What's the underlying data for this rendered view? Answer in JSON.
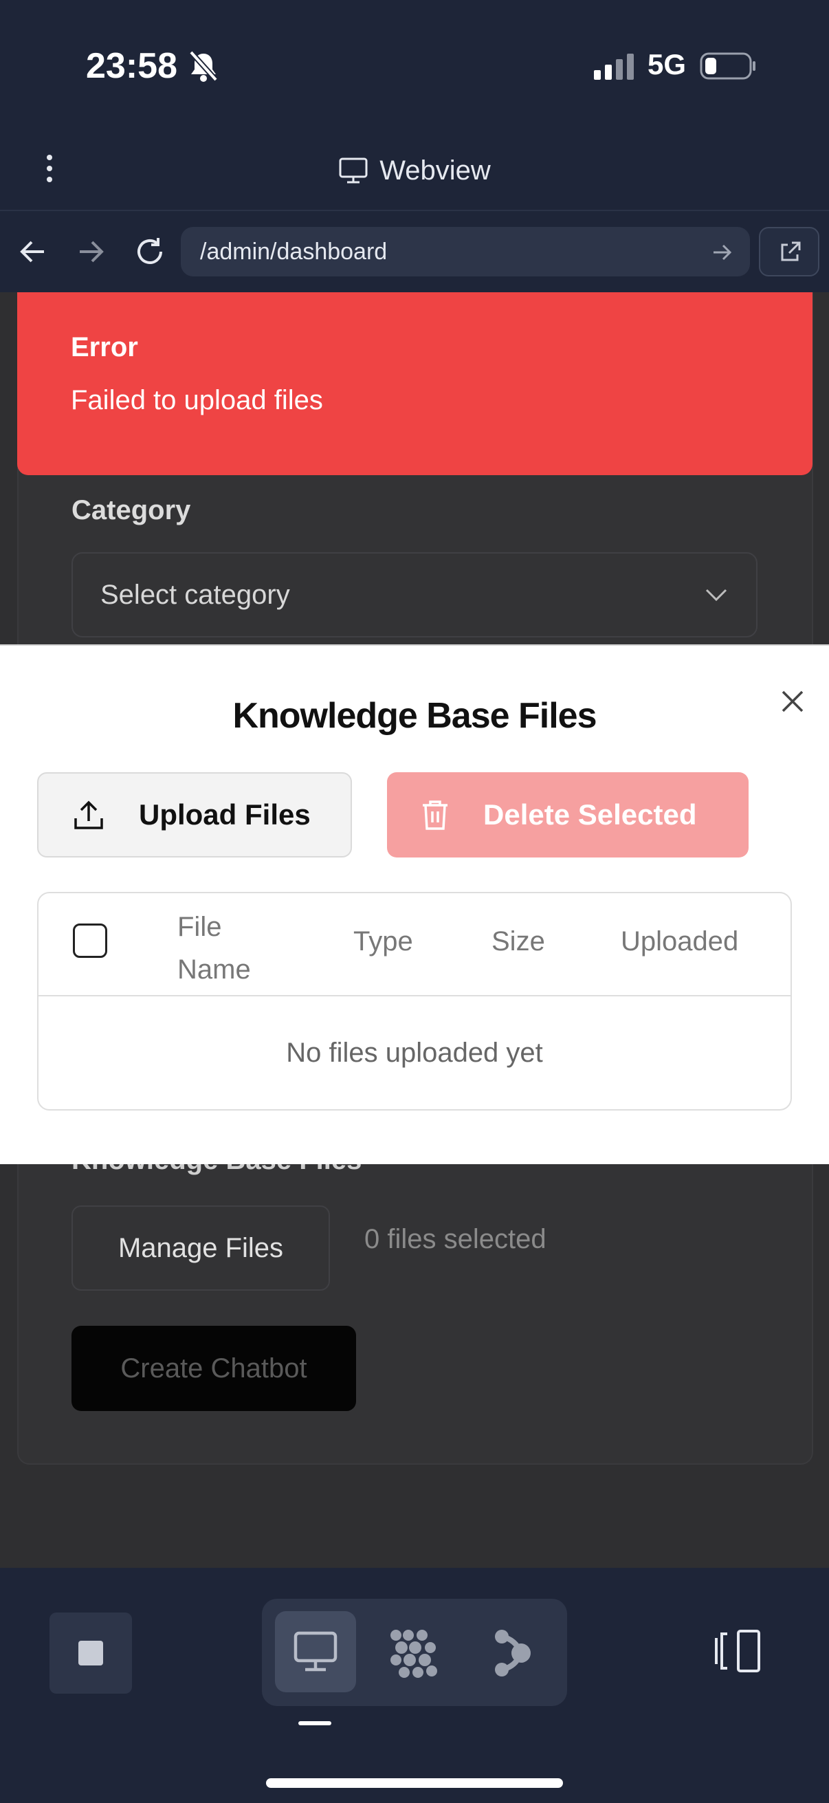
{
  "status_bar": {
    "time": "23:58",
    "network": "5G",
    "icons": [
      "bell-slash-icon",
      "signal-icon",
      "battery-icon"
    ]
  },
  "webview": {
    "title": "Webview",
    "url": "/admin/dashboard",
    "icons": [
      "more-vertical-icon",
      "monitor-icon",
      "back-arrow-icon",
      "forward-arrow-icon",
      "reload-icon",
      "go-arrow-icon",
      "external-link-icon"
    ]
  },
  "toast": {
    "title": "Error",
    "message": "Failed to upload files",
    "color": "#ef4444"
  },
  "page": {
    "category_label": "Category",
    "category_placeholder": "Select category",
    "kb_label": "Knowledge Base Files",
    "manage_button": "Manage Files",
    "selected_count": "0 files selected",
    "create_button": "Create Chatbot"
  },
  "modal": {
    "title": "Knowledge Base Files",
    "upload_button": "Upload Files",
    "delete_button": "Delete Selected",
    "table": {
      "columns": [
        "File Name",
        "Type",
        "Size",
        "Uploaded"
      ],
      "empty_text": "No files uploaded yet"
    }
  },
  "bottom_bar": {
    "icons": [
      "stop-icon",
      "monitor-icon",
      "dots-grid-icon",
      "flow-icon",
      "split-view-icon"
    ]
  }
}
